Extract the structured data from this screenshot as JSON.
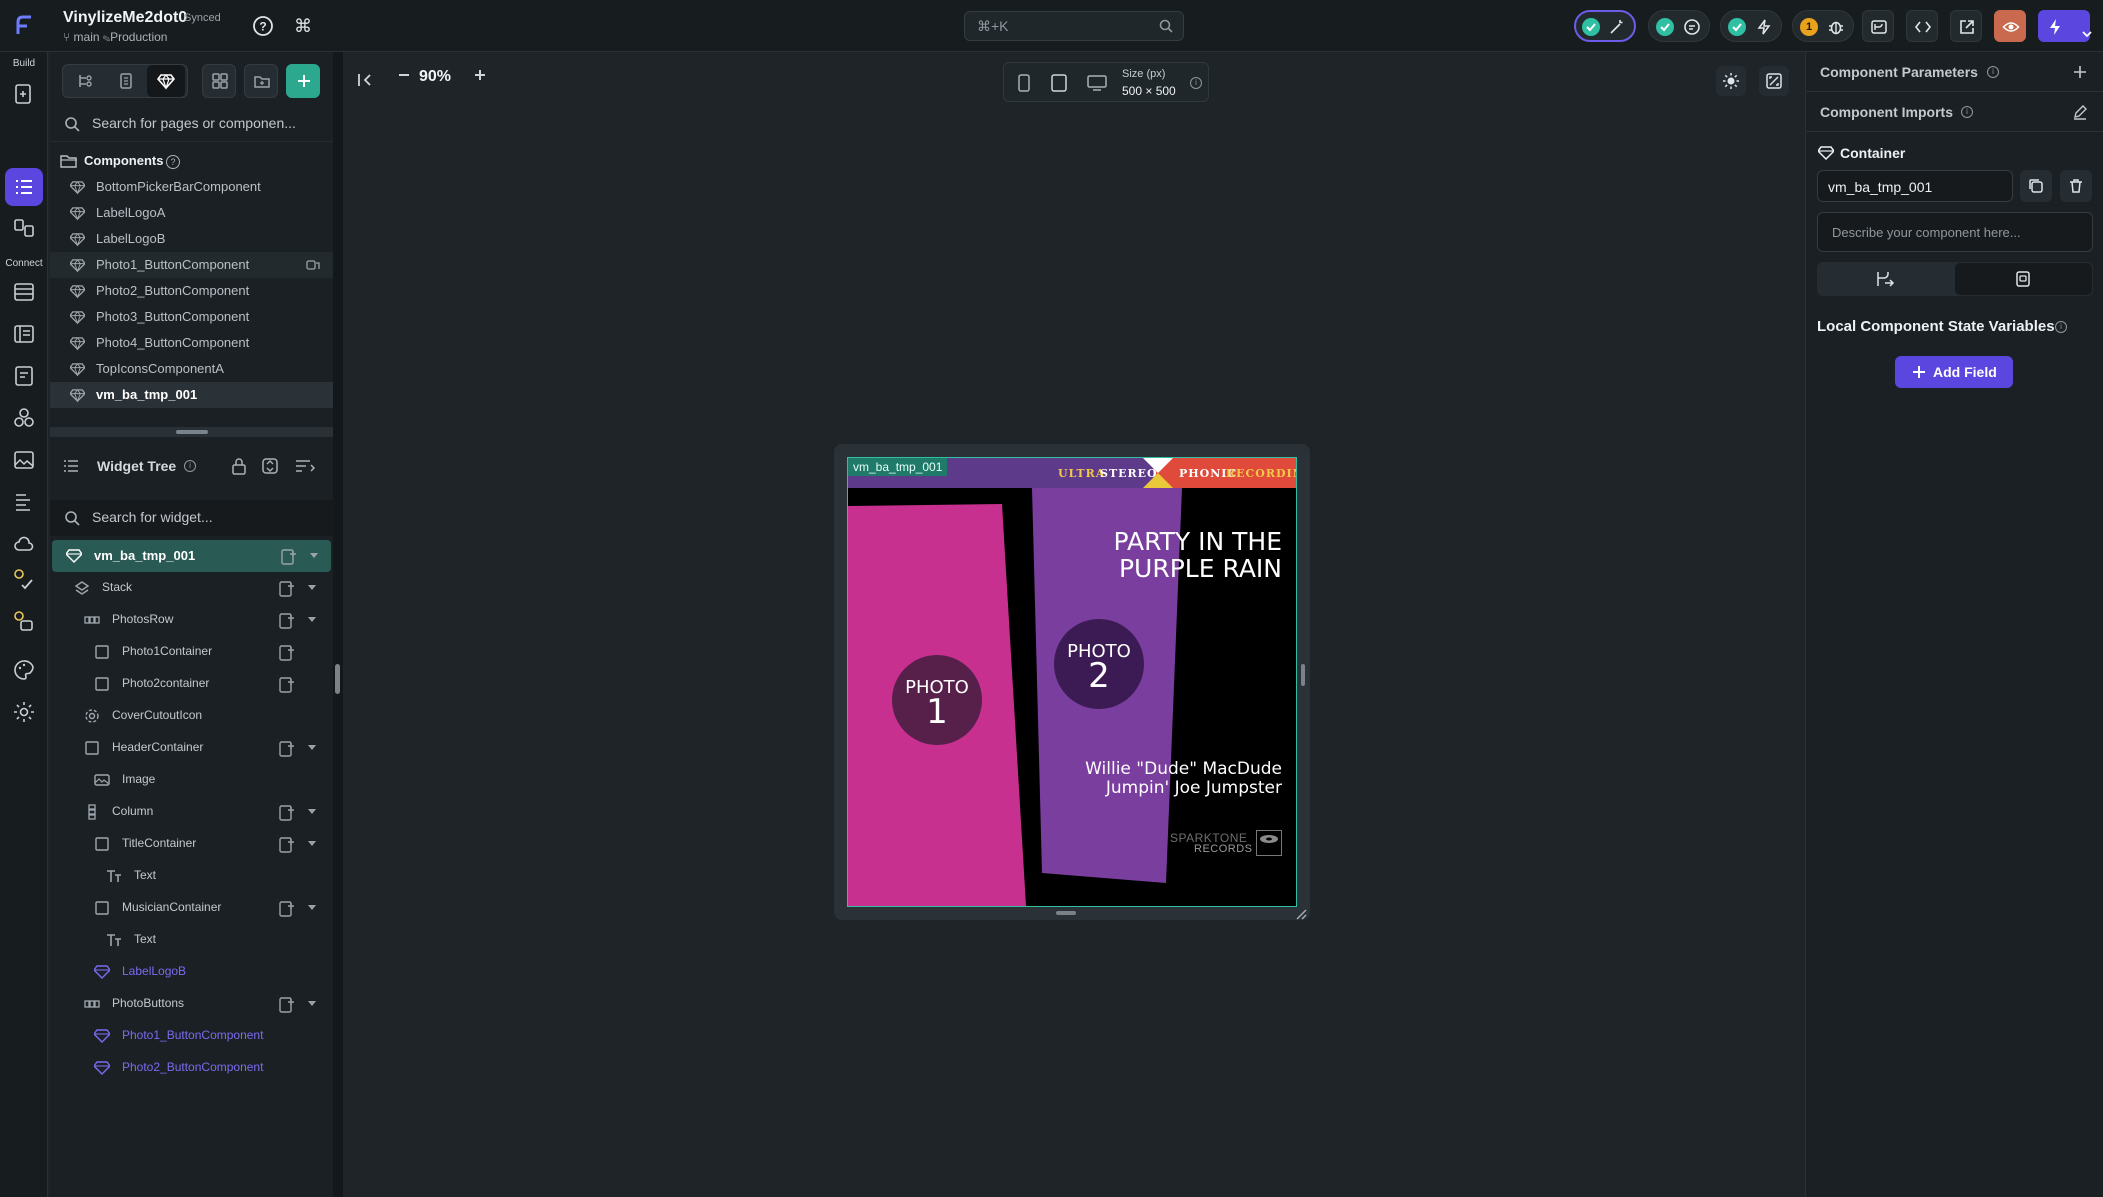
{
  "project": {
    "name": "VinylizeMe2dot0",
    "sync_status": "Synced",
    "branch": "main",
    "environment": "Production"
  },
  "command_search": {
    "placeholder": "⌘+K"
  },
  "top_status": {
    "notification_count": "1"
  },
  "rail": {
    "build_label": "Build",
    "connect_label": "Connect"
  },
  "left_panel": {
    "search_pages_placeholder": "Search for pages or componen...",
    "components_header": "Components",
    "components": [
      "BottomPickerBarComponent",
      "LabelLogoA",
      "LabelLogoB",
      "Photo1_ButtonComponent",
      "Photo2_ButtonComponent",
      "Photo3_ButtonComponent",
      "Photo4_ButtonComponent",
      "TopIconsComponentA",
      "vm_ba_tmp_001"
    ],
    "widget_tree_title": "Widget Tree",
    "search_widget_placeholder": "Search for widget...",
    "widget_tree": [
      {
        "label": "vm_ba_tmp_001",
        "icon": "component-icon",
        "depth": 0,
        "add": true,
        "caret": true,
        "selected": true
      },
      {
        "label": "Stack",
        "icon": "layers-icon",
        "depth": 1,
        "add": true,
        "caret": true
      },
      {
        "label": "PhotosRow",
        "icon": "row-icon",
        "depth": 2,
        "add": true,
        "caret": true
      },
      {
        "label": "Photo1Container",
        "icon": "container-icon",
        "depth": 3,
        "add": true,
        "caret": false
      },
      {
        "label": "Photo2container",
        "icon": "container-icon",
        "depth": 3,
        "add": true,
        "caret": false
      },
      {
        "label": "CoverCutoutIcon",
        "icon": "gear-icon",
        "depth": 2,
        "add": false,
        "caret": false
      },
      {
        "label": "HeaderContainer",
        "icon": "container-icon",
        "depth": 2,
        "add": true,
        "caret": true
      },
      {
        "label": "Image",
        "icon": "image-icon",
        "depth": 3,
        "add": false,
        "caret": false
      },
      {
        "label": "Column",
        "icon": "column-icon",
        "depth": 2,
        "add": true,
        "caret": true
      },
      {
        "label": "TitleContainer",
        "icon": "container-icon",
        "depth": 3,
        "add": true,
        "caret": true
      },
      {
        "label": "Text",
        "icon": "text-icon",
        "depth": 4,
        "add": false,
        "caret": false
      },
      {
        "label": "MusicianContainer",
        "icon": "container-icon",
        "depth": 3,
        "add": true,
        "caret": true
      },
      {
        "label": "Text",
        "icon": "text-icon",
        "depth": 4,
        "add": false,
        "caret": false
      },
      {
        "label": "LabelLogoB",
        "icon": "component-icon",
        "depth": 3,
        "add": false,
        "caret": false,
        "accent": true
      },
      {
        "label": "PhotoButtons",
        "icon": "row-icon",
        "depth": 2,
        "add": true,
        "caret": true
      },
      {
        "label": "Photo1_ButtonComponent",
        "icon": "component-icon",
        "depth": 3,
        "add": false,
        "caret": false,
        "accent": true
      },
      {
        "label": "Photo2_ButtonComponent",
        "icon": "component-icon",
        "depth": 3,
        "add": false,
        "caret": false,
        "accent": true
      }
    ]
  },
  "canvas": {
    "zoom": "90%",
    "size_label": "Size (px)",
    "size_value": "500 × 500",
    "selection_tag": "vm_ba_tmp_001"
  },
  "album": {
    "header_left_1": "ULTRA",
    "header_left_2": "STEREO",
    "header_right_1": "PHONIC",
    "header_right_2": "RECORDING",
    "title_line1": "PARTY IN THE",
    "title_line2": "PURPLE RAIN",
    "photo1_label": "PHOTO",
    "photo1_num": "1",
    "photo2_label": "PHOTO",
    "photo2_num": "2",
    "musician1": "Willie \"Dude\" MacDude",
    "musician2": "Jumpin' Joe Jumpster",
    "logo_line1": "SPARKTONE",
    "logo_line2": "RECORDS"
  },
  "right_panel": {
    "params_title": "Component Parameters",
    "imports_title": "Component Imports",
    "container_label": "Container",
    "name_value": "vm_ba_tmp_001",
    "description_placeholder": "Describe your component here...",
    "state_vars_title": "Local Component State Variables",
    "add_field_label": "Add Field"
  },
  "colors": {
    "accent": "#5b47e0",
    "teal": "#2fbfa2",
    "magenta": "#c8308f",
    "purple": "#7a3e9e",
    "header_purple": "#5d3a8a"
  }
}
